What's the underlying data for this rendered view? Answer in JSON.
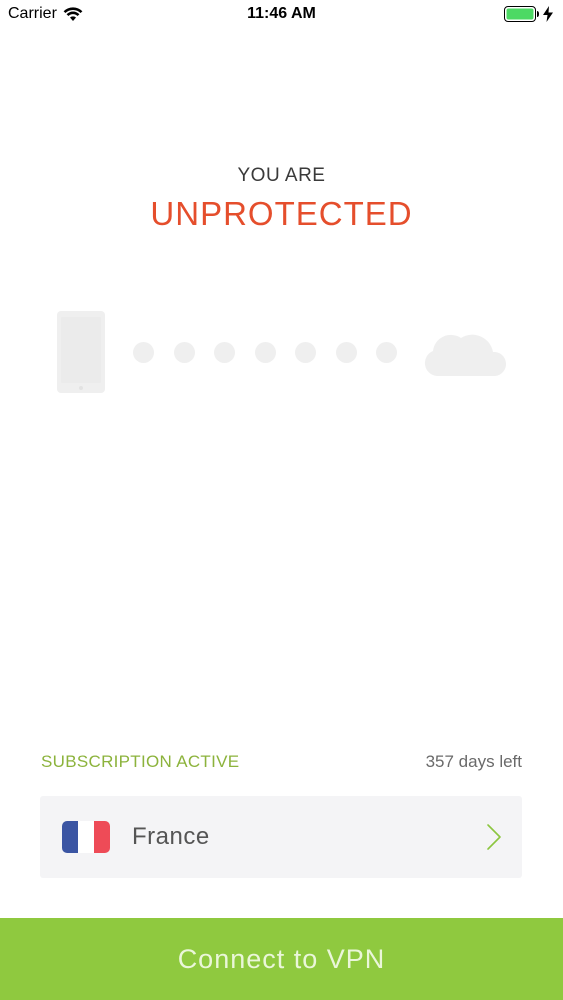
{
  "status_bar": {
    "carrier": "Carrier",
    "time": "11:46 AM",
    "wifi_icon": "wifi-icon",
    "battery_icon": "battery-icon",
    "charging_icon": "lightning-bolt-icon"
  },
  "protection": {
    "prefix": "YOU ARE",
    "status": "UNPROTECTED",
    "status_color": "#e54e2c"
  },
  "illustration": {
    "device_icon": "phone-icon",
    "server_icon": "cloud-icon",
    "dot_count": 7
  },
  "subscription": {
    "label": "SUBSCRIPTION ACTIVE",
    "days_left": "357 days left",
    "label_color": "#8cb33c"
  },
  "location": {
    "country": "France",
    "flag_icon": "france-flag-icon",
    "chevron_icon": "chevron-right-icon"
  },
  "connect_button": {
    "label": "Connect to VPN",
    "color": "#8fc93f"
  }
}
